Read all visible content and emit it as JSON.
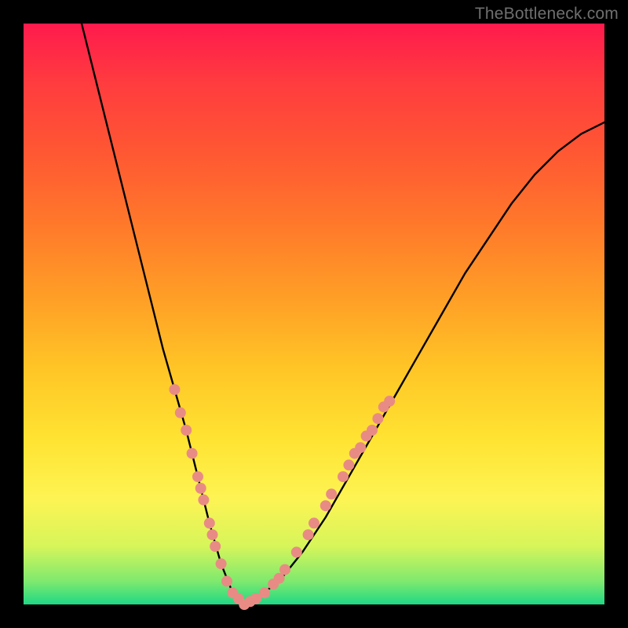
{
  "watermark": "TheBottleneck.com",
  "chart_data": {
    "type": "line",
    "title": "",
    "xlabel": "",
    "ylabel": "",
    "xlim": [
      0,
      100
    ],
    "ylim": [
      0,
      100
    ],
    "series": [
      {
        "name": "bottleneck-curve",
        "x": [
          10,
          12,
          14,
          16,
          18,
          20,
          22,
          24,
          26,
          28,
          30,
          32,
          34,
          36,
          38,
          40,
          44,
          48,
          52,
          56,
          60,
          64,
          68,
          72,
          76,
          80,
          84,
          88,
          92,
          96,
          100
        ],
        "y": [
          100,
          92,
          84,
          76,
          68,
          60,
          52,
          44,
          37,
          30,
          22,
          14,
          7,
          2,
          0,
          1,
          4,
          9,
          15,
          22,
          29,
          36,
          43,
          50,
          57,
          63,
          69,
          74,
          78,
          81,
          83
        ]
      }
    ],
    "markers": {
      "name": "highlight-dots",
      "color": "#e98b85",
      "points": [
        {
          "x": 26,
          "y": 37
        },
        {
          "x": 27,
          "y": 33
        },
        {
          "x": 28,
          "y": 30
        },
        {
          "x": 29,
          "y": 26
        },
        {
          "x": 30,
          "y": 22
        },
        {
          "x": 30.5,
          "y": 20
        },
        {
          "x": 31,
          "y": 18
        },
        {
          "x": 32,
          "y": 14
        },
        {
          "x": 32.5,
          "y": 12
        },
        {
          "x": 33,
          "y": 10
        },
        {
          "x": 34,
          "y": 7
        },
        {
          "x": 35,
          "y": 4
        },
        {
          "x": 36,
          "y": 2
        },
        {
          "x": 37,
          "y": 1
        },
        {
          "x": 38,
          "y": 0
        },
        {
          "x": 39,
          "y": 0.5
        },
        {
          "x": 40,
          "y": 1
        },
        {
          "x": 41.5,
          "y": 2
        },
        {
          "x": 43,
          "y": 3.5
        },
        {
          "x": 44,
          "y": 4.5
        },
        {
          "x": 45,
          "y": 6
        },
        {
          "x": 47,
          "y": 9
        },
        {
          "x": 49,
          "y": 12
        },
        {
          "x": 50,
          "y": 14
        },
        {
          "x": 52,
          "y": 17
        },
        {
          "x": 53,
          "y": 19
        },
        {
          "x": 55,
          "y": 22
        },
        {
          "x": 56,
          "y": 24
        },
        {
          "x": 57,
          "y": 26
        },
        {
          "x": 58,
          "y": 27
        },
        {
          "x": 59,
          "y": 29
        },
        {
          "x": 60,
          "y": 30
        },
        {
          "x": 61,
          "y": 32
        },
        {
          "x": 62,
          "y": 34
        },
        {
          "x": 63,
          "y": 35
        }
      ]
    }
  }
}
